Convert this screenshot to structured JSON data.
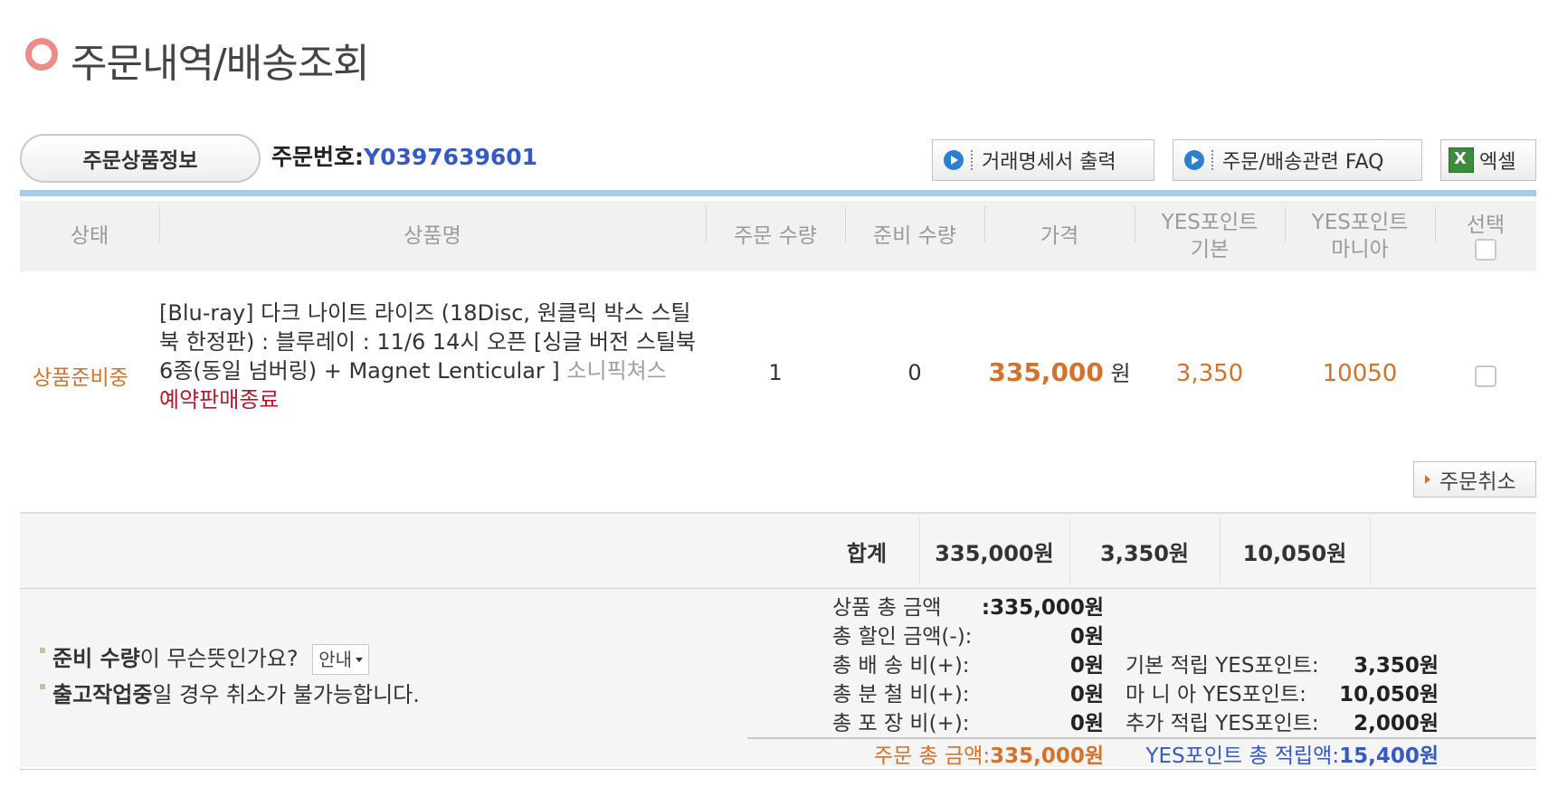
{
  "page": {
    "title": "주문내역/배송조회"
  },
  "order": {
    "tab_label": "주문상품정보",
    "number_label": "주문번호:",
    "number_value": "Y0397639601"
  },
  "actions": {
    "statement_label": "거래명세서 출력",
    "faq_label": "주문/배송관련 FAQ",
    "excel_label": "엑셀"
  },
  "table": {
    "headers": {
      "status": "상태",
      "product": "상품명",
      "order_qty": "주문 수량",
      "ready_qty": "준비 수량",
      "price": "가격",
      "yes_basic_line1": "YES포인트",
      "yes_basic_line2": "기본",
      "yes_mania_line1": "YES포인트",
      "yes_mania_line2": "마니아",
      "select": "선택"
    },
    "rows": [
      {
        "status": "상품준비중",
        "product_name": "[Blu-ray] 다크 나이트 라이즈 (18Disc, 원클릭 박스 스틸북 한정판) : 블루레이 : 11/6 14시 오픈 [싱글 버전 스틸북 6종(동일 넘버링) + Magnet Lenticular ]",
        "maker": "소니픽쳐스",
        "presale_status": "예약판매종료",
        "order_qty": "1",
        "ready_qty": "0",
        "price": "335,000",
        "price_unit": "원",
        "yes_basic": "3,350",
        "yes_mania": "10050"
      }
    ],
    "cancel_label": "주문취소"
  },
  "summary": {
    "label": "합계",
    "price": "335,000원",
    "yes_basic": "3,350원",
    "yes_mania": "10,050원"
  },
  "notes": {
    "note1_bold": "준비 수량",
    "note1_rest": "이 무슨뜻인가요?",
    "guide_label": "안내",
    "note2_bold": "출고작업중",
    "note2_rest": "일 경우 취소가 불가능합니다."
  },
  "breakdown": [
    {
      "label": "상품 총 금액",
      "value": ":335,000원"
    },
    {
      "label": "총 할인 금액(-):",
      "value": "0원"
    },
    {
      "label": "총 배 송 비(+):",
      "value": "0원"
    },
    {
      "label": "총 분 철 비(+):",
      "value": "0원"
    },
    {
      "label": "총 포 장 비(+):",
      "value": "0원"
    }
  ],
  "points": [
    {
      "label": "기본 적립 YES포인트:",
      "value": "3,350원"
    },
    {
      "label": "마 니 아 YES포인트:",
      "value": "10,050원"
    },
    {
      "label": "추가 적립 YES포인트:",
      "value": "2,000원"
    }
  ],
  "grand": {
    "order_label": "주문 총 금액:",
    "order_value": "335,000원",
    "points_label": "YES포인트 총 적립액:",
    "points_value": "15,400원"
  },
  "colors": {
    "accent_orange": "#d4722b",
    "link_blue": "#3559c7",
    "presale_red": "#b3192f",
    "header_bar": "#a9cbe6"
  }
}
